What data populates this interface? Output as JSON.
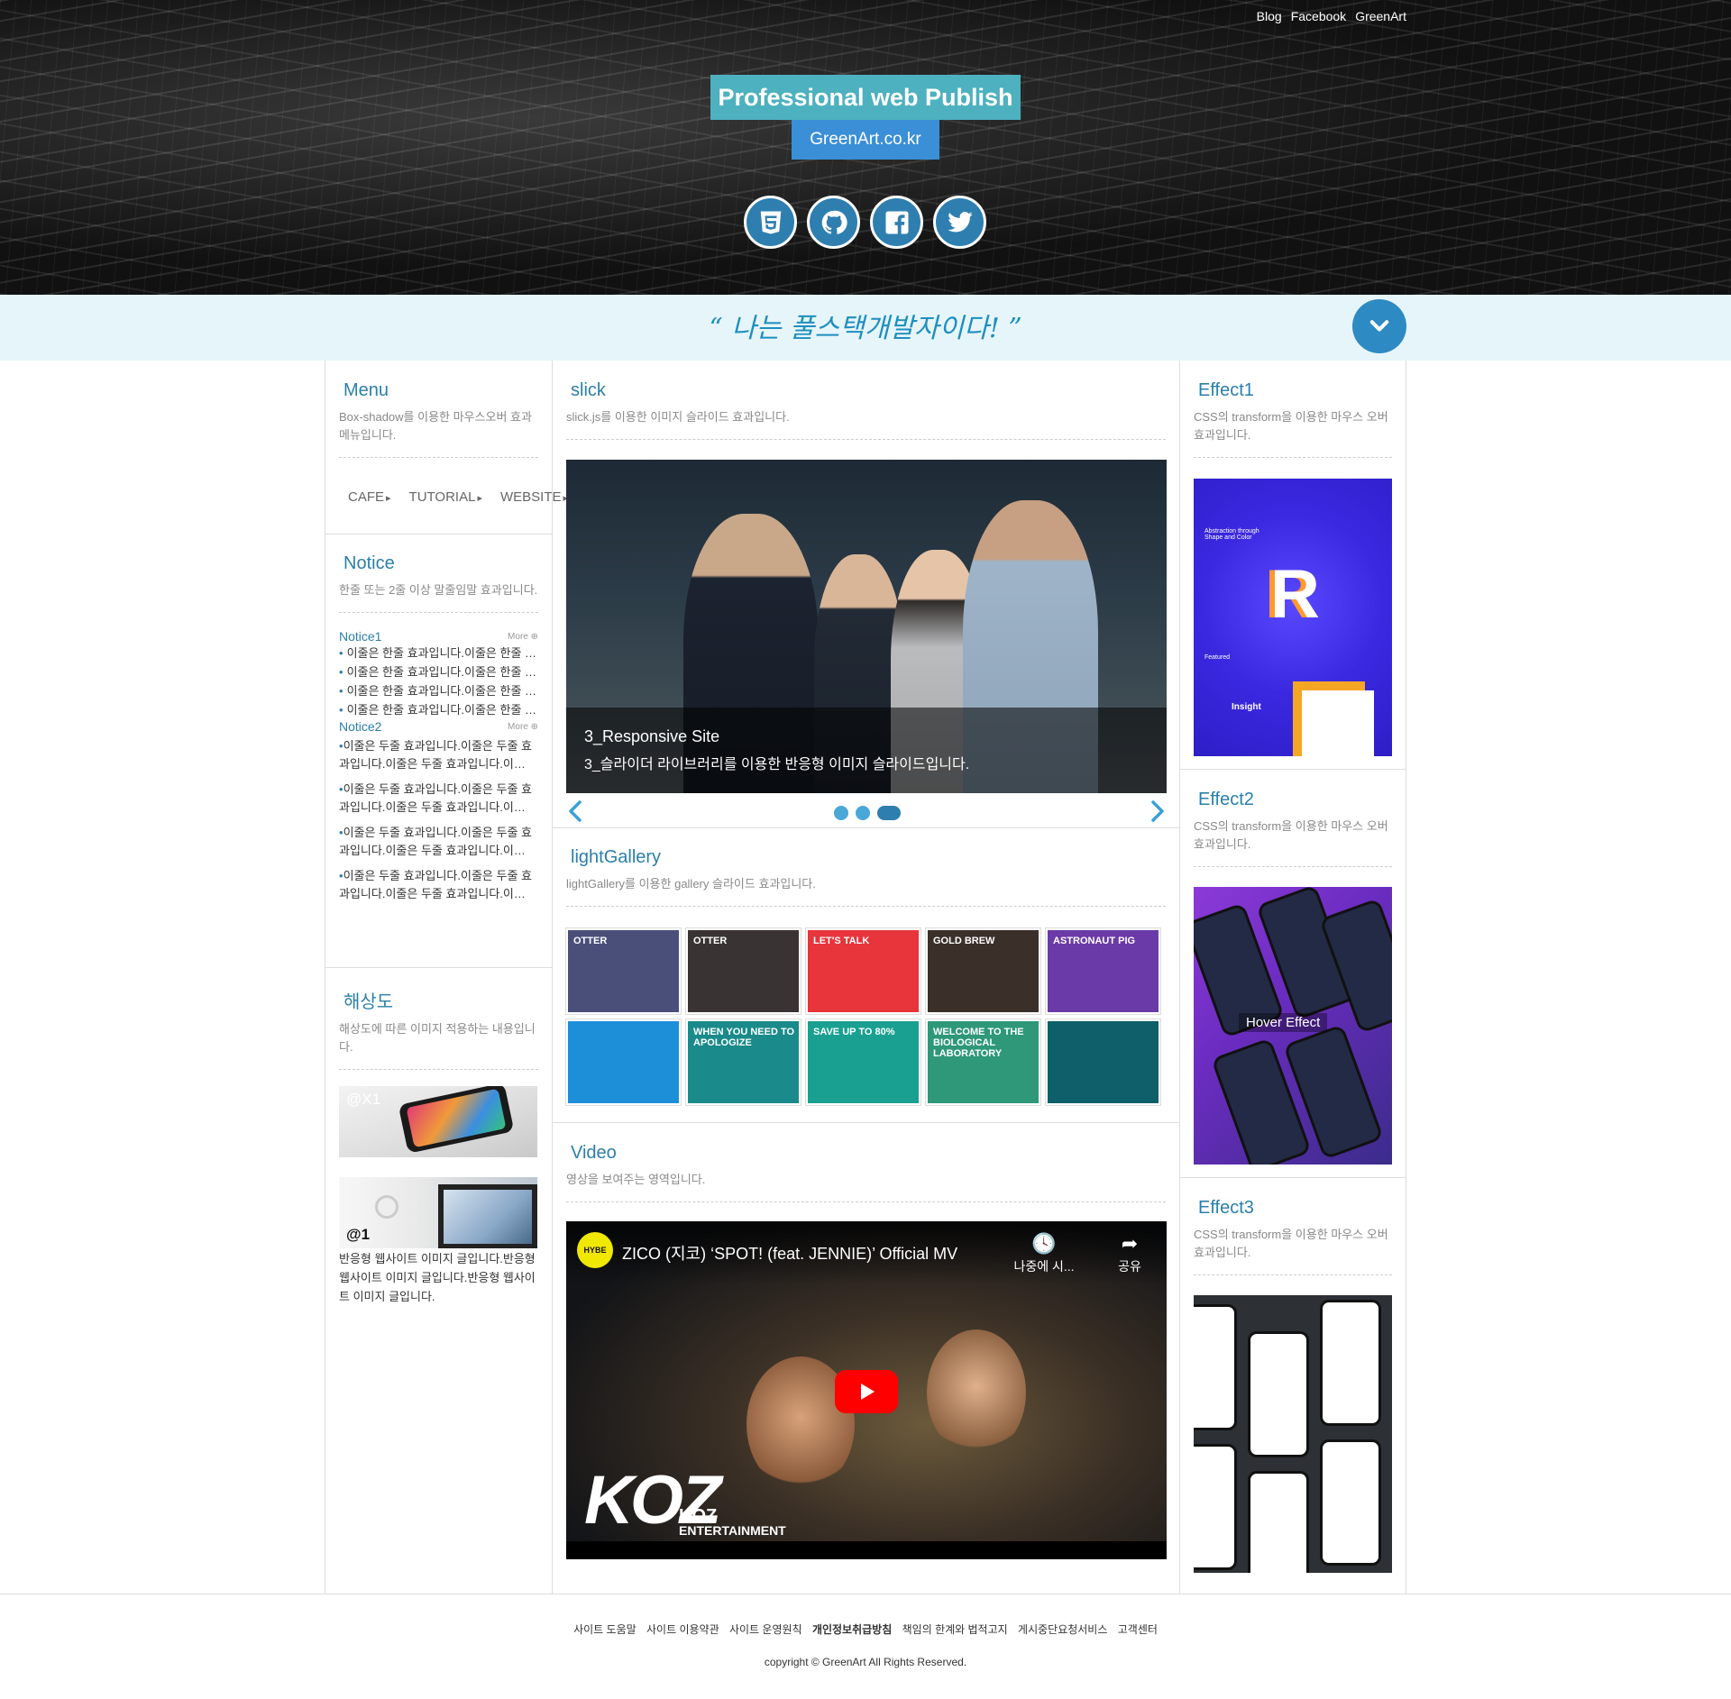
{
  "header": {
    "top_links": [
      "Blog",
      "Facebook",
      "GreenArt"
    ],
    "title": "Professional web Publish",
    "subtitle": "GreenArt.co.kr",
    "social_icons": [
      "html5-icon",
      "github-icon",
      "facebook-icon",
      "twitter-icon"
    ]
  },
  "quote": "“ 나는 풀스택개발자이다! ”",
  "left": {
    "menu": {
      "title": "Menu",
      "desc": "Box-shadow를 이용한 마우스오버 효과 메뉴입니다.",
      "items": [
        "CAFE",
        "TUTORIAL",
        "WEBSITE"
      ]
    },
    "notice": {
      "title": "Notice",
      "desc": "한줄 또는 2줄 이상 말줄임말 효과입니다.",
      "notice1_title": "Notice1",
      "notice1_more": "More ⊕",
      "notice1_items": [
        "이줄은 한줄 효과입니다.이줄은 한줄 효과입니다.",
        "이줄은 한줄 효과입니다.이줄은 한줄 효과입니다.",
        "이줄은 한줄 효과입니다.이줄은 한줄 효과입니다.",
        "이줄은 한줄 효과입니다.이줄은 한줄 효과입니다."
      ],
      "notice2_title": "Notice2",
      "notice2_more": "More ⊕",
      "notice2_items": [
        "이줄은 두줄 효과입니다.이줄은 두줄 효과입니다.이줄은 두줄 효과입니다.이…",
        "이줄은 두줄 효과입니다.이줄은 두줄 효과입니다.이줄은 두줄 효과입니다.이…",
        "이줄은 두줄 효과입니다.이줄은 두줄 효과입니다.이줄은 두줄 효과입니다.이…",
        "이줄은 두줄 효과입니다.이줄은 두줄 효과입니다.이줄은 두줄 효과입니다.이…"
      ]
    },
    "resolution": {
      "title": "해상도",
      "desc": "해상도에 따른 이미지 적용하는 내용입니다.",
      "img1_label": "@X1",
      "img2_label": "@1",
      "text": "반응형 웹사이트 이미지 글입니다.반응형 웹사이트 이미지 글입니다.반응형 웹사이트 이미지 글입니다."
    }
  },
  "middle": {
    "slick": {
      "title": "slick",
      "desc": "slick.js를 이용한 이미지 슬라이드 효과입니다.",
      "caption_title": "3_Responsive Site",
      "caption_desc": "3_슬라이더 라이브러리를 이용한 반응형 이미지 슬라이드입니다.",
      "dots": 3,
      "active_dot": 3
    },
    "gallery": {
      "title": "lightGallery",
      "desc": "lightGallery를 이용한 gallery 슬라이드 효과입니다.",
      "items": [
        {
          "label": "OTTER",
          "bg": "#4a4f7a"
        },
        {
          "label": "OTTER",
          "bg": "#3a3334"
        },
        {
          "label": "LET'S TALK",
          "bg": "#e8343b"
        },
        {
          "label": "GOLD BREW",
          "bg": "#3b2f2a"
        },
        {
          "label": "ASTRONAUT PIG",
          "bg": "#6a3aa8"
        },
        {
          "label": "",
          "bg": "#1d8fd8"
        },
        {
          "label": "WHEN YOU NEED TO APOLOGIZE",
          "bg": "#1a8a8a"
        },
        {
          "label": "SAVE UP TO 80%",
          "bg": "#1aa090"
        },
        {
          "label": "WELCOME TO THE BIOLOGICAL LABORATORY",
          "bg": "#2e9878"
        },
        {
          "label": "",
          "bg": "#0f5f6a"
        }
      ]
    },
    "video": {
      "title": "Video",
      "desc": "영상을 보여주는 영역입니다.",
      "channel": "HYBE",
      "video_title": "ZICO (지코) ‘SPOT! (feat. JENNIE)’ Official MV",
      "watch_later": "나중에 시...",
      "share": "공유",
      "brand": "KOZ",
      "brand_sub1": "KOZ",
      "brand_sub2": "ENTERTAINMENT"
    }
  },
  "right": {
    "effect1": {
      "title": "Effect1",
      "desc": "CSS의 transform을 이용한 마우스 오버 효과입니다.",
      "img_text1": "Abstraction through Shape and Color",
      "img_text2": "Featured",
      "img_text3": "Insight",
      "big_letter": "R"
    },
    "effect2": {
      "title": "Effect2",
      "desc": "CSS의 transform을 이용한 마우스 오버 효과입니다.",
      "hover_label": "Hover Effect"
    },
    "effect3": {
      "title": "Effect3",
      "desc": "CSS의 transform을 이용한 마우스 오버 효과입니다."
    }
  },
  "footer": {
    "links": [
      "사이트 도움말",
      "사이트 이용약관",
      "사이트 운영원칙",
      "개인정보취급방침",
      "책임의 한계와 법적고지",
      "게시중단요청서비스",
      "고객센터"
    ],
    "bold_link_index": 3,
    "copyright": "copyright © GreenArt All Rights Reserved."
  },
  "colors": {
    "accent": "#2b7fa8",
    "title_box": "#4db1bf",
    "subtitle_box": "#3a8fd6",
    "quote_bg": "#e6f5fa"
  }
}
